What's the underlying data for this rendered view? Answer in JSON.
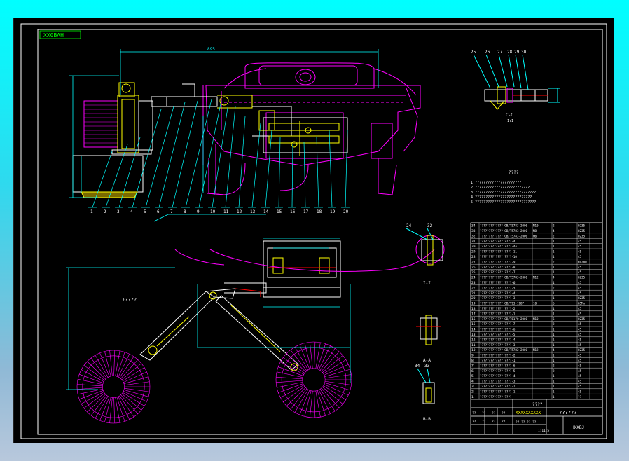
{
  "title_tag": "XX0BAH",
  "top_dimension": "895",
  "top_leaders": [
    "1",
    "2",
    "3",
    "4",
    "5",
    "6",
    "7",
    "8",
    "9",
    "10",
    "11",
    "12",
    "13",
    "14",
    "15",
    "16",
    "17",
    "18",
    "19",
    "20"
  ],
  "section_marks": {
    "top_right": [
      "25",
      "26",
      "27",
      "28",
      "29",
      "30"
    ],
    "cc_label": "C-C",
    "cc_scale": "1:1",
    "note_heading": "????",
    "mid_right": [
      "24",
      "32"
    ],
    "a_label": "A-A",
    "b_label": "B-B",
    "bottom_right": [
      "34",
      "33"
    ],
    "i_label": "I-I"
  },
  "notes": [
    "1.??????????????????????",
    "2.??????????????????????????",
    "3.?????????????????????????????",
    "4.???????????????????????????",
    "5.?????????????????????????????"
  ],
  "center_label": "↑????",
  "bom_rows": [
    {
      "no": "34",
      "name": "????????????? GB/T5783-2000",
      "code": "M10",
      "qty": "2",
      "mat": "Q235"
    },
    {
      "no": "33",
      "name": "????????????? GB/T5783-2000",
      "code": "M8",
      "qty": "4",
      "mat": "Q235"
    },
    {
      "no": "32",
      "name": "????????????? GB/T5783-2000",
      "code": "M6",
      "qty": "2",
      "mat": "Q235"
    },
    {
      "no": "31",
      "name": "????????????? ????-4",
      "code": "",
      "qty": "1",
      "mat": "45"
    },
    {
      "no": "30",
      "name": "????????????? ????-4A",
      "code": "",
      "qty": "1",
      "mat": "45"
    },
    {
      "no": "29",
      "name": "????????????? ????-11",
      "code": "",
      "qty": "1",
      "mat": "45"
    },
    {
      "no": "28",
      "name": "????????????? ????-10",
      "code": "",
      "qty": "1",
      "mat": "45"
    },
    {
      "no": "27",
      "name": "????????????? ????-9",
      "code": "",
      "qty": "2",
      "mat": "HT200"
    },
    {
      "no": "26",
      "name": "????????????? ????-8",
      "code": "",
      "qty": "1",
      "mat": "45"
    },
    {
      "no": "25",
      "name": "????????????? ????-7",
      "code": "",
      "qty": "1",
      "mat": "45"
    },
    {
      "no": "24",
      "name": "????????????? GB/T5783-2000",
      "code": "M12",
      "qty": "4",
      "mat": "Q235"
    },
    {
      "no": "23",
      "name": "????????????? ????-6",
      "code": "",
      "qty": "1",
      "mat": "45"
    },
    {
      "no": "22",
      "name": "????????????? ????-5",
      "code": "",
      "qty": "2",
      "mat": "45"
    },
    {
      "no": "21",
      "name": "????????????? ????-4",
      "code": "",
      "qty": "1",
      "mat": "45"
    },
    {
      "no": "20",
      "name": "????????????? ????-3",
      "code": "",
      "qty": "1",
      "mat": "Q235"
    },
    {
      "no": "19",
      "name": "????????????? GB/T93-1987",
      "code": "10",
      "qty": "6",
      "mat": "65Mn"
    },
    {
      "no": "18",
      "name": "????????????? ????-2",
      "code": "",
      "qty": "1",
      "mat": "45"
    },
    {
      "no": "17",
      "name": "????????????? ????-1",
      "code": "",
      "qty": "1",
      "mat": "45"
    },
    {
      "no": "16",
      "name": "????????????? GB/T6170-2000",
      "code": "M10",
      "qty": "6",
      "mat": "Q235"
    },
    {
      "no": "15",
      "name": "????????????? ????-7",
      "code": "",
      "qty": "2",
      "mat": "45"
    },
    {
      "no": "14",
      "name": "????????????? ????-6",
      "code": "",
      "qty": "1",
      "mat": "45"
    },
    {
      "no": "13",
      "name": "????????????? ????-5",
      "code": "",
      "qty": "1",
      "mat": "45"
    },
    {
      "no": "12",
      "name": "????????????? ????-4",
      "code": "",
      "qty": "1",
      "mat": "45"
    },
    {
      "no": "11",
      "name": "????????????? ????-3",
      "code": "",
      "qty": "1",
      "mat": "45"
    },
    {
      "no": "10",
      "name": "????????????? GB/T5782-2000",
      "code": "M12",
      "qty": "4",
      "mat": "Q235"
    },
    {
      "no": "9",
      "name": "????????????? ????-2",
      "code": "",
      "qty": "1",
      "mat": "45"
    },
    {
      "no": "8",
      "name": "????????????? ????-1",
      "code": "",
      "qty": "1",
      "mat": "45"
    },
    {
      "no": "7",
      "name": "????????????? ????-6",
      "code": "",
      "qty": "2",
      "mat": "45"
    },
    {
      "no": "6",
      "name": "????????????? ????-5",
      "code": "",
      "qty": "2",
      "mat": "45"
    },
    {
      "no": "5",
      "name": "????????????? ????-4",
      "code": "",
      "qty": "1",
      "mat": "45"
    },
    {
      "no": "4",
      "name": "????????????? ????-3",
      "code": "",
      "qty": "1",
      "mat": "45"
    },
    {
      "no": "3",
      "name": "????????????? ????-2",
      "code": "",
      "qty": "1",
      "mat": "45"
    },
    {
      "no": "2",
      "name": "????????????? ????-1",
      "code": "",
      "qty": "1",
      "mat": "45"
    },
    {
      "no": "1",
      "name": "????????????? ????",
      "code": "",
      "qty": "1",
      "mat": "??"
    }
  ],
  "title_block": {
    "header": "????",
    "drawing_no": "XXXXXXXXXX",
    "project": "??????",
    "company": "HXXBJ",
    "cells": [
      "??",
      "??",
      "??",
      "??",
      "??",
      "??",
      "??",
      "??"
    ],
    "scale_row": [
      "??",
      "??",
      "??",
      "??",
      "1:1",
      "1:5"
    ]
  },
  "colors": {
    "frame": "#ffffff",
    "truck": "#ff00ff",
    "parts": "#ffff00",
    "dims": "#00ffff",
    "frame_inner": "#00ff00",
    "text": "#00ff00"
  }
}
